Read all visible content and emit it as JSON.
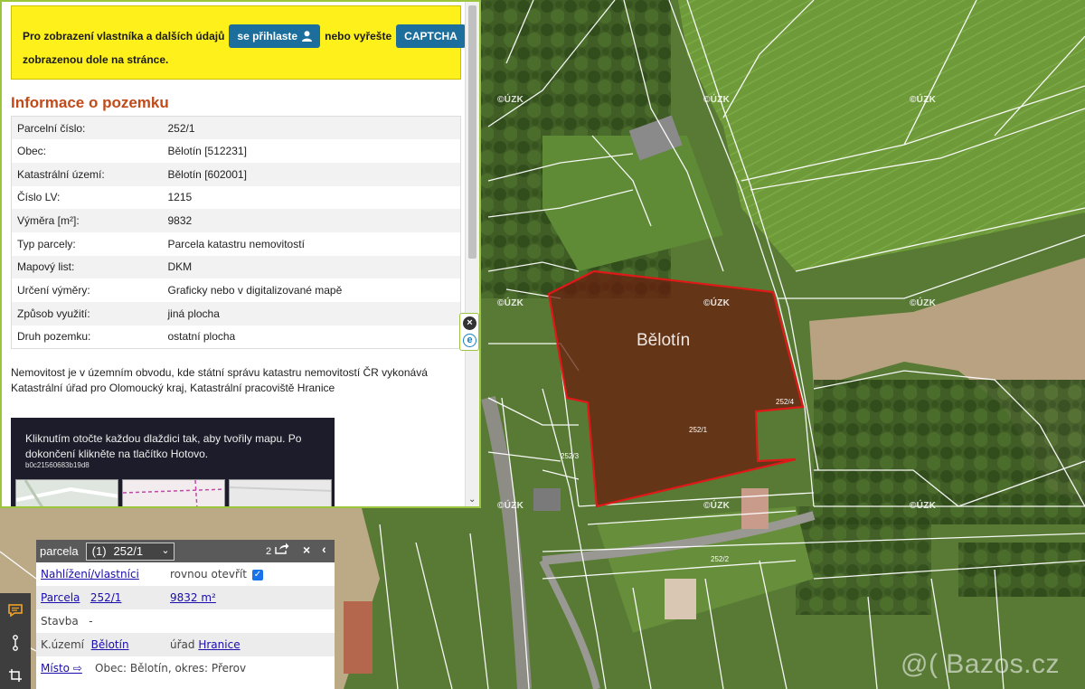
{
  "map": {
    "watermark": "©ÚZK",
    "parcel_label": "Bělotín",
    "pin_label": "252/1",
    "plot_labels": [
      "252/4",
      "252/2",
      "252/3"
    ],
    "site_watermark": "@( Bazos.cz",
    "colors": {
      "parcel_outline": "#e01818",
      "parcel_fill": "#6a1a0c",
      "pin": "#1e88e5"
    }
  },
  "notice": {
    "text_before": "Pro zobrazení vlastníka a dalších údajů",
    "login_button": "se přihlaste",
    "text_middle": "nebo vyřešte",
    "captcha_button": "CAPTCHA",
    "text_after": "zobrazenou dole na stránce."
  },
  "info": {
    "title": "Informace o pozemku",
    "rows": [
      {
        "label": "Parcelní číslo:",
        "value": "252/1"
      },
      {
        "label": "Obec:",
        "value": "Bělotín [512231]"
      },
      {
        "label": "Katastrální území:",
        "value": "Bělotín [602001]"
      },
      {
        "label": "Číslo LV:",
        "value": "1215"
      },
      {
        "label": "Výměra [m²]:",
        "value": "9832"
      },
      {
        "label": "Typ parcely:",
        "value": "Parcela katastru nemovitostí"
      },
      {
        "label": "Mapový list:",
        "value": "DKM"
      },
      {
        "label": "Určení výměry:",
        "value": "Graficky nebo v digitalizované mapě"
      },
      {
        "label": "Způsob využití:",
        "value": "jiná plocha"
      },
      {
        "label": "Druh pozemku:",
        "value": "ostatní plocha"
      }
    ],
    "note": "Nemovitost je v územním obvodu, kde státní správu katastru nemovitostí ČR vykonává Katastrální úřad pro Olomoucký kraj, Katastrální pracoviště Hranice"
  },
  "captcha": {
    "instruction": "Kliknutím otočte každou dlaždici tak, aby tvořily mapu. Po dokončení klikněte na tlačítko Hotovo.",
    "id": "b0c21560683b19d8"
  },
  "side_tools": {
    "close_icon": "close-circle-icon",
    "edge_icon": "edge-browser-icon"
  },
  "popup": {
    "header_label": "parcela",
    "select_index": "(1)",
    "select_value": "252/1",
    "count": "2",
    "rows": {
      "nahlizeni": "Nahlížení/vlastníci",
      "open_label": "rovnou otevřít",
      "parcela_label": "Parcela",
      "parcela_value": "252/1",
      "parcela_area": "9832 m²",
      "stavba_label": "Stavba",
      "stavba_value": "-",
      "ku_label": "K.území",
      "ku_value": "Bělotín",
      "urad_label": "úřad",
      "urad_value": "Hranice",
      "misto_label": "Místo ⇨",
      "misto_value": "Obec: Bělotín, okres: Přerov"
    }
  },
  "toolbar": {
    "icons": [
      "comment-icon",
      "ruler-icon",
      "crop-icon"
    ]
  }
}
